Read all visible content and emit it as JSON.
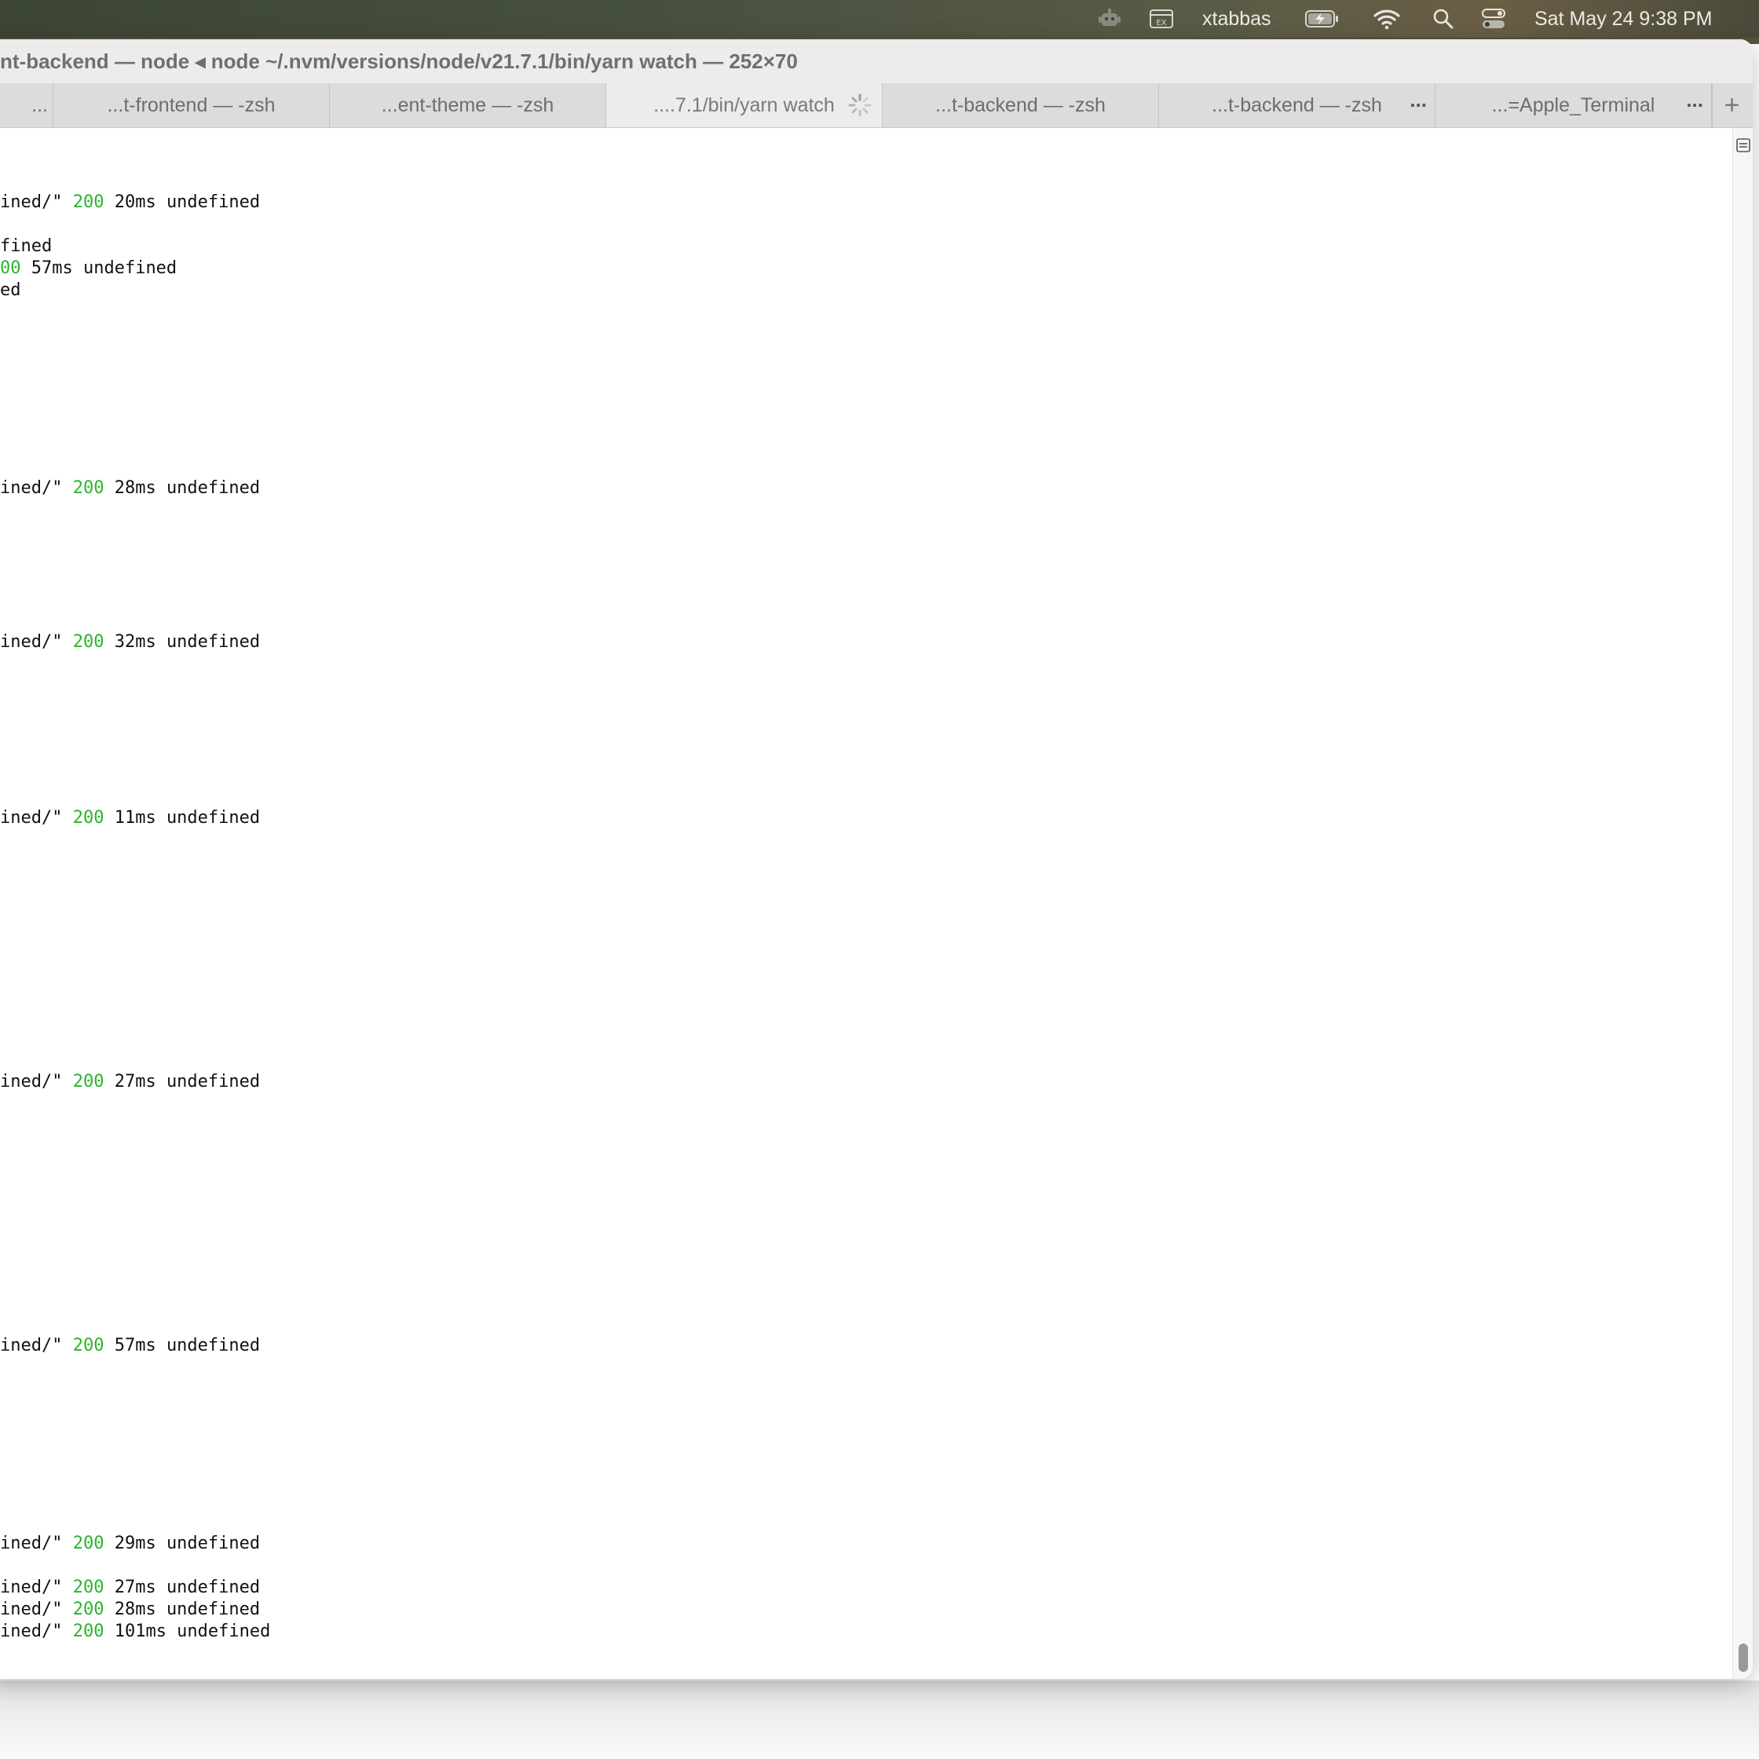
{
  "menubar": {
    "username": "xtabbas",
    "datetime": "Sat May 24  9:38 PM",
    "icons": [
      "robot-icon",
      "input-source-icon",
      "battery-charging-icon",
      "wifi-icon",
      "search-icon",
      "control-center-icon"
    ]
  },
  "window": {
    "title": "nt-backend — node ◂ node ~/.nvm/versions/node/v21.7.1/bin/yarn watch — 252×70",
    "tabs": [
      {
        "label": "..."
      },
      {
        "label": "...t-frontend — -zsh"
      },
      {
        "label": "...ent-theme — -zsh"
      },
      {
        "label": "....7.1/bin/yarn watch",
        "active": true
      },
      {
        "label": "...t-backend — -zsh"
      },
      {
        "label": "...t-backend — -zsh"
      },
      {
        "label": "...=Apple_Terminal"
      }
    ],
    "tab_more": "...",
    "new_tab": "+"
  },
  "terminal": {
    "status_color": "#2ab52a",
    "lines": [
      {
        "pre": "ined/\" ",
        "status": "200",
        "post": " 20ms undefined"
      },
      {
        "pre": "fined",
        "status": "",
        "post": ""
      },
      {
        "pre": "",
        "status": "00",
        "post": " 57ms undefined"
      },
      {
        "pre": "ed",
        "status": "",
        "post": ""
      },
      {
        "pre": "ined/\" ",
        "status": "200",
        "post": " 28ms undefined"
      },
      {
        "pre": "ined/\" ",
        "status": "200",
        "post": " 32ms undefined"
      },
      {
        "pre": "ined/\" ",
        "status": "200",
        "post": " 11ms undefined"
      },
      {
        "pre": "ined/\" ",
        "status": "200",
        "post": " 27ms undefined"
      },
      {
        "pre": "ined/\" ",
        "status": "200",
        "post": " 57ms undefined"
      },
      {
        "pre": "ined/\" ",
        "status": "200",
        "post": " 29ms undefined"
      },
      {
        "pre": "ined/\" ",
        "status": "200",
        "post": " 27ms undefined"
      },
      {
        "pre": "ined/\" ",
        "status": "200",
        "post": " 28ms undefined"
      },
      {
        "pre": "ined/\" ",
        "status": "200",
        "post": " 101ms undefined"
      }
    ]
  }
}
